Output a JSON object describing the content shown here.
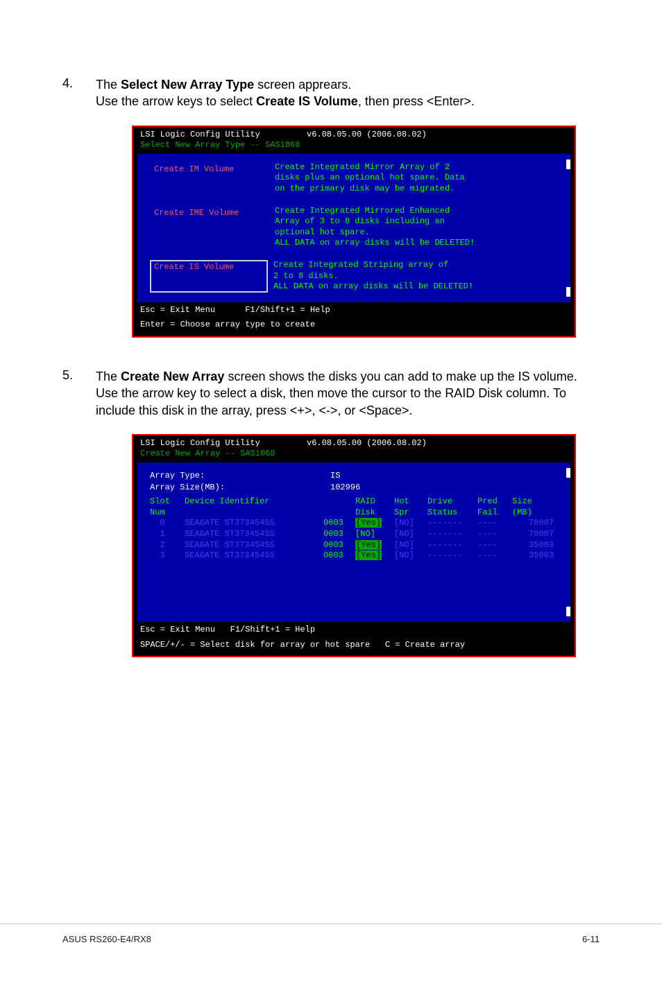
{
  "step4": {
    "num": "4.",
    "line1_a": "The ",
    "line1_b": "Select New Array Type",
    "line1_c": " screen apprears.",
    "line2_a": "Use the arrow keys to select ",
    "line2_b": "Create IS Volume",
    "line2_c": ", then press <Enter>."
  },
  "bios1": {
    "title_left": "LSI Logic Config Utility",
    "title_mid": "v6.08.05.00 (2006.08.02)",
    "subtitle": "Select New Array Type -- SAS1068",
    "items": [
      {
        "label": "Create IM Volume",
        "selected": false,
        "desc": "Create Integrated Mirror Array of 2\ndisks plus an optional hot spare. Data\non the primary disk may be migrated."
      },
      {
        "label": "Create IME Volume",
        "selected": false,
        "desc": "Create Integrated Mirrored Enhanced\nArray of 3 to 8 disks including an\noptional hot spare.\nALL DATA on array disks will be DELETED!"
      },
      {
        "label": "Create IS Volume",
        "selected": true,
        "desc": "Create Integrated Striping array of\n2 to 8 disks.\nALL DATA on array disks will be DELETED!"
      }
    ],
    "footer1": "Esc = Exit Menu      F1/Shift+1 = Help",
    "footer2": "Enter = Choose array type to create"
  },
  "step5": {
    "num": "5.",
    "t1": "The ",
    "b1": "Create New Array",
    "t2": " screen shows the disks you can add to make up the IS volume. Use the arrow key to select a disk, then move the cursor to the RAID Disk column. To include this disk in the array, press <+>, <->, or <Space>."
  },
  "bios2": {
    "title_left": "LSI Logic Config Utility",
    "title_mid": "v6.08.05.00 (2006.08.02)",
    "subtitle": "Create New Array -- SAS1068",
    "array_type_label": "Array Type:",
    "array_type_val": "IS",
    "array_size_label": "Array Size(MB):",
    "array_size_val": "102996",
    "hdr": {
      "slot": "Slot",
      "num": "Num",
      "dev": "Device Identifier",
      "raid": "RAID",
      "disk": "Disk",
      "hot": "Hot",
      "spr": "Spr",
      "drive": "Drive",
      "status": "Status",
      "pred": "Pred",
      "fail": "Fail",
      "size": "Size",
      "mb": "(MB)"
    },
    "rows": [
      {
        "slot": "0",
        "dev": "SEAGATE ST373454SS",
        "rev": "0003",
        "raid": "[Yes]",
        "yes": true,
        "hot": "[NO]",
        "drive": "-------",
        "pred": "----",
        "size": "70007"
      },
      {
        "slot": "1",
        "dev": "SEAGATE ST373454SS",
        "rev": "0003",
        "raid": "[NO]",
        "yes": false,
        "hot": "[NO]",
        "drive": "-------",
        "pred": "----",
        "size": "70007"
      },
      {
        "slot": "2",
        "dev": "SEAGATE ST373454SS",
        "rev": "0003",
        "raid": "[Yes]",
        "yes": true,
        "hot": "[NO]",
        "drive": "-------",
        "pred": "----",
        "size": "35003"
      },
      {
        "slot": "3",
        "dev": "SEAGATE ST373454SS",
        "rev": "0003",
        "raid": "[Yes]",
        "yes": true,
        "hot": "[NO]",
        "drive": "-------",
        "pred": "----",
        "size": "35003"
      }
    ],
    "footer1": "Esc = Exit Menu   F1/Shift+1 = Help",
    "footer2": "SPACE/+/- = Select disk for array or hot spare   C = Create array"
  },
  "page_footer": {
    "left": "ASUS RS260-E4/RX8",
    "right": "6-11"
  }
}
